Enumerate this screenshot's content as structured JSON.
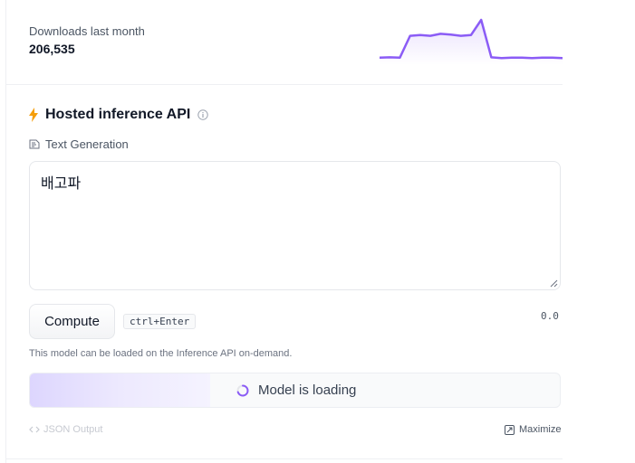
{
  "downloads": {
    "label": "Downloads last month",
    "value": "206,535",
    "trend": [
      0.05,
      0.06,
      0.05,
      0.6,
      0.62,
      0.6,
      0.65,
      0.63,
      0.6,
      0.62,
      1.0,
      0.06,
      0.04,
      0.05,
      0.05,
      0.04,
      0.05,
      0.05,
      0.04
    ]
  },
  "inference": {
    "title": "Hosted inference API",
    "task": "Text Generation",
    "input_value": "배고파",
    "compute_label": "Compute",
    "shortcut": "ctrl+Enter",
    "time": "0.0",
    "load_note": "This model can be loaded on the Inference API on-demand.",
    "loading_text": "Model is loading",
    "loading_progress": 0.34,
    "json_output_label": "JSON Output",
    "maximize_label": "Maximize"
  },
  "colors": {
    "accent": "#8b5cf6",
    "bolt": "#f59e0b"
  },
  "icons": [
    "bolt-icon",
    "info-icon",
    "task-tag-icon",
    "spinner-icon",
    "code-icon",
    "maximize-icon"
  ]
}
